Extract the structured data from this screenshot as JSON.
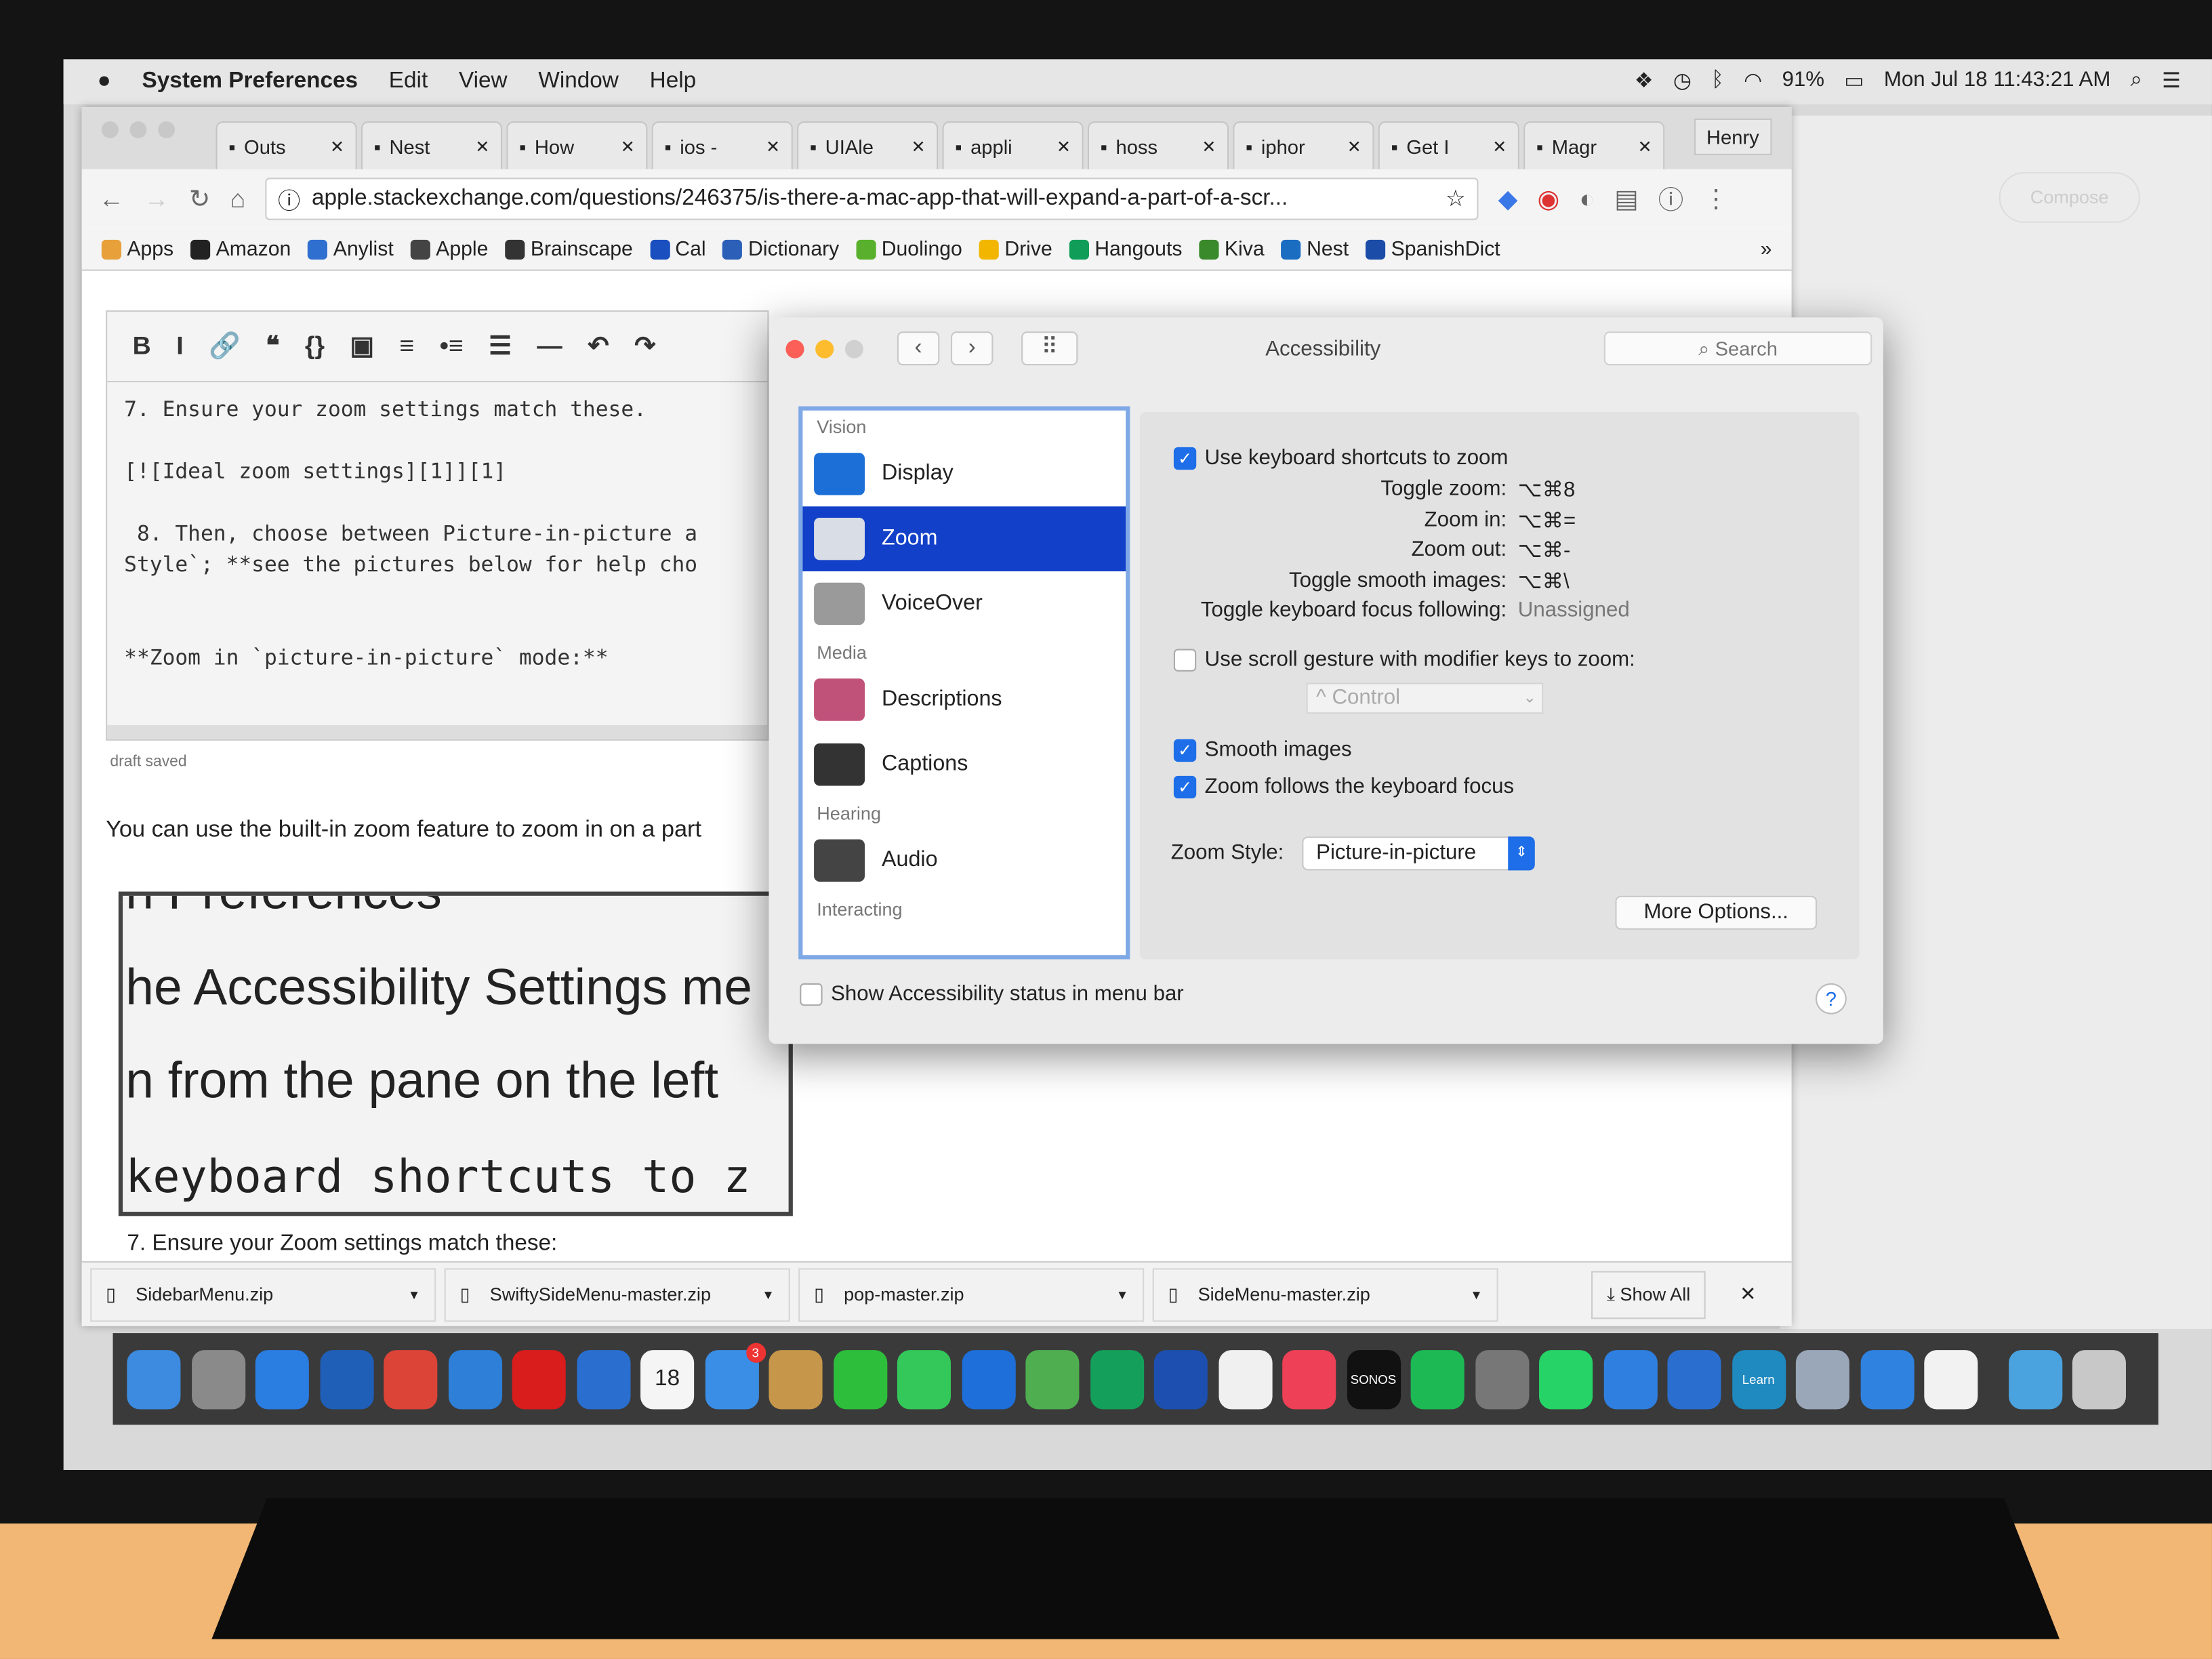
{
  "menubar": {
    "apple": "",
    "app": "System Preferences",
    "items": [
      "Edit",
      "View",
      "Window",
      "Help"
    ],
    "battery": "91%",
    "clock": "Mon Jul 18  11:43:21 AM"
  },
  "browser": {
    "tabs": [
      {
        "label": "Outs",
        "icon": "dollar-icon"
      },
      {
        "label": "Nest",
        "icon": "page-icon"
      },
      {
        "label": "How",
        "icon": "swift-icon"
      },
      {
        "label": "ios -",
        "icon": "stackoverflow-icon"
      },
      {
        "label": "UIAle",
        "icon": "cloud-icon"
      },
      {
        "label": "appli",
        "icon": "command-icon"
      },
      {
        "label": "hoss",
        "icon": "github-icon"
      },
      {
        "label": "iphor",
        "icon": "google-icon"
      },
      {
        "label": "Get I",
        "icon": "apple-icon"
      },
      {
        "label": "Magr",
        "icon": "page-icon"
      }
    ],
    "profile": "Henry",
    "url": "apple.stackexchange.com/questions/246375/is-there-a-mac-app-that-will-expand-a-part-of-a-scr...",
    "bookmarks": [
      {
        "label": "Apps",
        "color": "#e8a03a"
      },
      {
        "label": "Amazon",
        "color": "#222222"
      },
      {
        "label": "Anylist",
        "color": "#2f6fd0"
      },
      {
        "label": "Apple",
        "color": "#444444"
      },
      {
        "label": "Brainscape",
        "color": "#333333"
      },
      {
        "label": "Cal",
        "color": "#1a4fc0"
      },
      {
        "label": "Dictionary",
        "color": "#2c5fb8"
      },
      {
        "label": "Duolingo",
        "color": "#58b02c"
      },
      {
        "label": "Drive",
        "color": "#f2b600"
      },
      {
        "label": "Hangouts",
        "color": "#0f9d58"
      },
      {
        "label": "Kiva",
        "color": "#3a8a2c"
      },
      {
        "label": "Nest",
        "color": "#1b6dc1"
      },
      {
        "label": "SpanishDict",
        "color": "#1b4da8"
      }
    ],
    "editor": {
      "toolbar": [
        "B",
        "I",
        "🔗",
        "❝",
        "{}",
        "▣",
        "≡",
        "•≡",
        "☰",
        "—",
        "↶",
        "↷"
      ],
      "text": "7. Ensure your zoom settings match these.\n\n[![Ideal zoom settings][1]][1]\n\n 8. Then, choose between Picture-in-picture a\nStyle`; **see the pictures below for help cho\n\n\n**Zoom in `picture-in-picture` mode:**"
    },
    "draft_status": "draft saved",
    "body_text": "You can use the built-in zoom feature to zoom in on a part",
    "lens_lines": [
      "n Preferences",
      "he Accessibility Settings me",
      "n   from the pane on the left",
      "keyboard shortcuts to z"
    ],
    "step7": "7. Ensure your Zoom settings match these:",
    "downloads": [
      "SidebarMenu.zip",
      "SwiftySideMenu-master.zip",
      "pop-master.zip",
      "SideMenu-master.zip"
    ],
    "show_all": "Show All",
    "behind": {
      "compose": "Compose"
    }
  },
  "accessibility": {
    "title": "Accessibility",
    "search_placeholder": "Search",
    "sidebar": [
      {
        "section": "Vision"
      },
      {
        "label": "Display",
        "color": "#1c6fd6"
      },
      {
        "label": "Zoom",
        "color": "#d9dde5",
        "selected": true
      },
      {
        "label": "VoiceOver",
        "color": "#9a9a9a"
      },
      {
        "section": "Media"
      },
      {
        "label": "Descriptions",
        "color": "#c0527a"
      },
      {
        "label": "Captions",
        "color": "#333333"
      },
      {
        "section": "Hearing"
      },
      {
        "label": "Audio",
        "color": "#444444"
      },
      {
        "section": "Interacting"
      }
    ],
    "use_shortcuts": {
      "label": "Use keyboard shortcuts to zoom",
      "checked": true
    },
    "shortcuts": [
      {
        "label": "Toggle zoom:",
        "value": "⌥⌘8"
      },
      {
        "label": "Zoom in:",
        "value": "⌥⌘="
      },
      {
        "label": "Zoom out:",
        "value": "⌥⌘-"
      },
      {
        "label": "Toggle smooth images:",
        "value": "⌥⌘\\"
      },
      {
        "label": "Toggle keyboard focus following:",
        "value": "Unassigned"
      }
    ],
    "scroll_gesture": {
      "label": "Use scroll gesture with modifier keys to zoom:",
      "checked": false,
      "modifier": "^ Control"
    },
    "smooth_images": {
      "label": "Smooth images",
      "checked": true
    },
    "follow_focus": {
      "label": "Zoom follows the keyboard focus",
      "checked": true
    },
    "zoom_style_label": "Zoom Style:",
    "zoom_style": "Picture-in-picture",
    "more_options": "More Options...",
    "status_menu": {
      "label": "Show Accessibility status in menu bar",
      "checked": false
    },
    "help": "?"
  },
  "accent": "#1d6ee8",
  "dock": [
    {
      "name": "finder",
      "color": "#3d8be0"
    },
    {
      "name": "launchpad",
      "color": "#8a8a8a"
    },
    {
      "name": "app-store",
      "color": "#2a7de1"
    },
    {
      "name": "1password",
      "color": "#1f5fb8"
    },
    {
      "name": "chrome",
      "color": "#db4437"
    },
    {
      "name": "safari",
      "color": "#2d7fd8"
    },
    {
      "name": "opera",
      "color": "#d91c1c"
    },
    {
      "name": "bluetooth",
      "color": "#2a6fd0"
    },
    {
      "name": "calendar",
      "color": "#f5f5f5",
      "text": "18"
    },
    {
      "name": "airmail",
      "color": "#3a8ee6",
      "badge": "3"
    },
    {
      "name": "contacts",
      "color": "#c6964a"
    },
    {
      "name": "evernote",
      "color": "#2dbe3c"
    },
    {
      "name": "facetime",
      "color": "#34c759"
    },
    {
      "name": "weather",
      "color": "#1e6fd9"
    },
    {
      "name": "maps",
      "color": "#4fae4f"
    },
    {
      "name": "grammarly",
      "color": "#14a05a"
    },
    {
      "name": "instruments",
      "color": "#1d4fb0"
    },
    {
      "name": "photos",
      "color": "#f0f0f0"
    },
    {
      "name": "pocket",
      "color": "#ee4056"
    },
    {
      "name": "sonos",
      "color": "#111111",
      "text": "SONOS"
    },
    {
      "name": "spotify",
      "color": "#1db954"
    },
    {
      "name": "system-preferences",
      "color": "#777777"
    },
    {
      "name": "whatsapp",
      "color": "#25d366"
    },
    {
      "name": "xcode",
      "color": "#2f7fe0"
    },
    {
      "name": "xcode-beta",
      "color": "#2a6fd0"
    },
    {
      "name": "learn",
      "color": "#1f8ac0",
      "text": "Learn"
    },
    {
      "name": "preview",
      "color": "#9aa7b8"
    },
    {
      "name": "folder",
      "color": "#2f82e0"
    },
    {
      "name": "itunes",
      "color": "#f2f2f2"
    },
    {
      "name": "downloads-folder",
      "color": "#4aa3df"
    },
    {
      "name": "trash",
      "color": "#c8c8c8"
    }
  ]
}
